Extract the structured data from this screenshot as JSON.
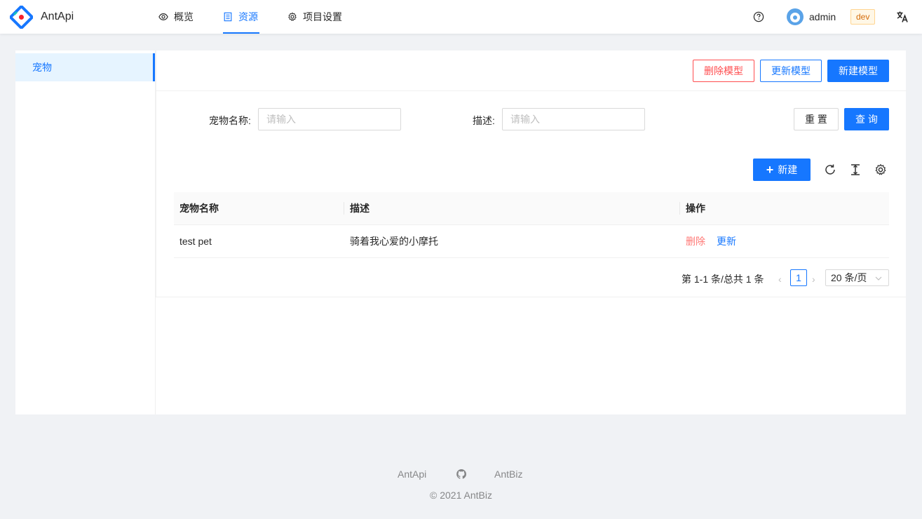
{
  "header": {
    "app_title": "AntApi",
    "nav": [
      {
        "label": "概览",
        "icon": "eye-icon"
      },
      {
        "label": "资源",
        "icon": "resource-icon"
      },
      {
        "label": "项目设置",
        "icon": "gear-icon"
      }
    ],
    "active_nav": "资源",
    "user_name": "admin",
    "env_tag": "dev",
    "colors": {
      "primary": "#1677ff",
      "danger": "#ff4d4f"
    }
  },
  "sidebar": {
    "items": [
      {
        "label": "宠物"
      }
    ],
    "selected": "宠物"
  },
  "toolbar": {
    "delete_model": "删除模型",
    "update_model": "更新模型",
    "new_model": "新建模型"
  },
  "search_form": {
    "name_label": "宠物名称:",
    "name_placeholder": "请输入",
    "desc_label": "描述:",
    "desc_placeholder": "请输入",
    "reset_label": "重 置",
    "query_label": "查 询"
  },
  "table_toolbar": {
    "new_label": "新建",
    "icons": [
      "reload-icon",
      "column-height-icon",
      "setting-icon"
    ]
  },
  "table": {
    "columns": [
      "宠物名称",
      "描述",
      "操作"
    ],
    "rows": [
      {
        "name": "test pet",
        "description": "骑着我心爱的小摩托",
        "actions": [
          "删除",
          "更新"
        ]
      }
    ]
  },
  "pagination": {
    "summary": "第 1-1 条/总共 1 条",
    "current_page": "1",
    "page_size": "20 条/页"
  },
  "footer": {
    "links": [
      "AntApi",
      "AntBiz"
    ],
    "github_icon": "github-icon",
    "copyright": "2021 AntBiz"
  }
}
